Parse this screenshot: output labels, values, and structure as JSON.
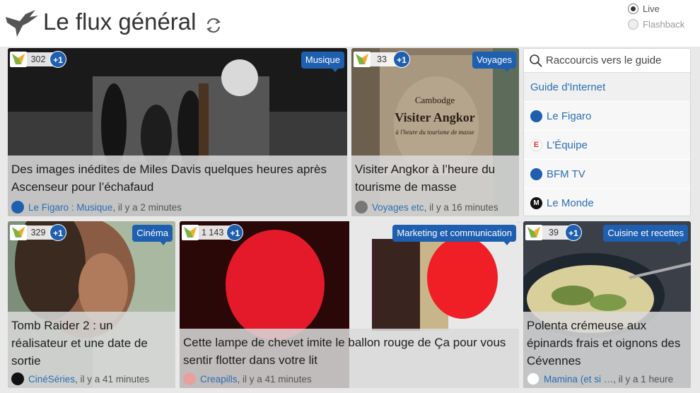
{
  "header": {
    "title": "Le flux général"
  },
  "mode": {
    "live_label": "Live",
    "flashback_label": "Flashback",
    "selected": "Live"
  },
  "guide": {
    "search_placeholder": "Raccourcis vers le guide",
    "heading": "Guide d'Internet",
    "items": [
      {
        "label": "Le Figaro",
        "icon": "figaro-icon"
      },
      {
        "label": "L'Équipe",
        "icon": "lequipe-icon"
      },
      {
        "label": "BFM TV",
        "icon": "bfmtv-icon"
      },
      {
        "label": "Le Monde",
        "icon": "lemonde-icon"
      }
    ]
  },
  "plus_label": "+1",
  "cards": [
    {
      "count": "302",
      "category": "Musique",
      "headline": "Des images inédites de Miles Davis quelques heures après Ascenseur pour l’échafaud",
      "source": "Le Figaro : Musique",
      "time": ", il y a 2 minutes"
    },
    {
      "count": "33",
      "category": "Voyages",
      "headline": "Visiter Angkor à l’heure du tourisme de masse",
      "source": "Voyages etc",
      "time": ", il y a 16 minutes",
      "image_text": [
        "Cambodge",
        "Visiter Angkor",
        "à l'heure du tourisme de masse"
      ]
    },
    {
      "count": "329",
      "category": "Cinéma",
      "headline": "Tomb Raider 2 : un réalisateur et une date de sortie",
      "source": "CinéSéries",
      "time": ", il y a 41 minutes"
    },
    {
      "count": "1 143",
      "category": "Marketing et communication",
      "headline": "Cette lampe de chevet imite le ballon rouge de Ça pour vous sentir flotter dans votre lit",
      "source": "Creapills",
      "time": ", il y a 41 minutes"
    },
    {
      "count": "39",
      "category": "Cuisine et recettes",
      "headline": "Polenta crémeuse aux épinards frais et oignons des Cévennes",
      "source": "Mamina (et si … ",
      "time": ", il y a 1 heure"
    }
  ],
  "colors": {
    "accent": "#1f5fb0",
    "link": "#2a6fb3"
  }
}
